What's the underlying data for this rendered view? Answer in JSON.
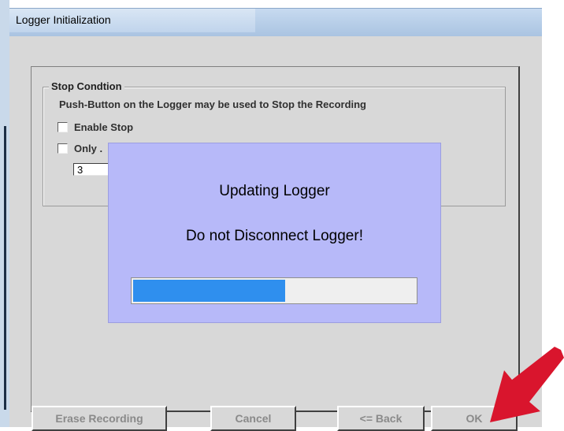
{
  "window": {
    "title": "Logger Initialization"
  },
  "stop_group": {
    "legend": "Stop Condtion",
    "description": "Push-Button on the Logger may be used to Stop the Recording",
    "enable_stop_label": "Enable Stop",
    "enable_stop_checked": false,
    "only_label": "Only .",
    "only_checked": false,
    "count_value": "3"
  },
  "modal": {
    "title": "Updating Logger",
    "message": "Do not Disconnect Logger!",
    "progress_fraction": 0.54
  },
  "buttons": {
    "erase": "Erase Recording",
    "cancel": "Cancel",
    "back": "<= Back",
    "ok": "OK"
  },
  "colors": {
    "modal_bg": "#b7b9f9",
    "progress_fill": "#2f8fee",
    "arrow": "#d9152d"
  }
}
